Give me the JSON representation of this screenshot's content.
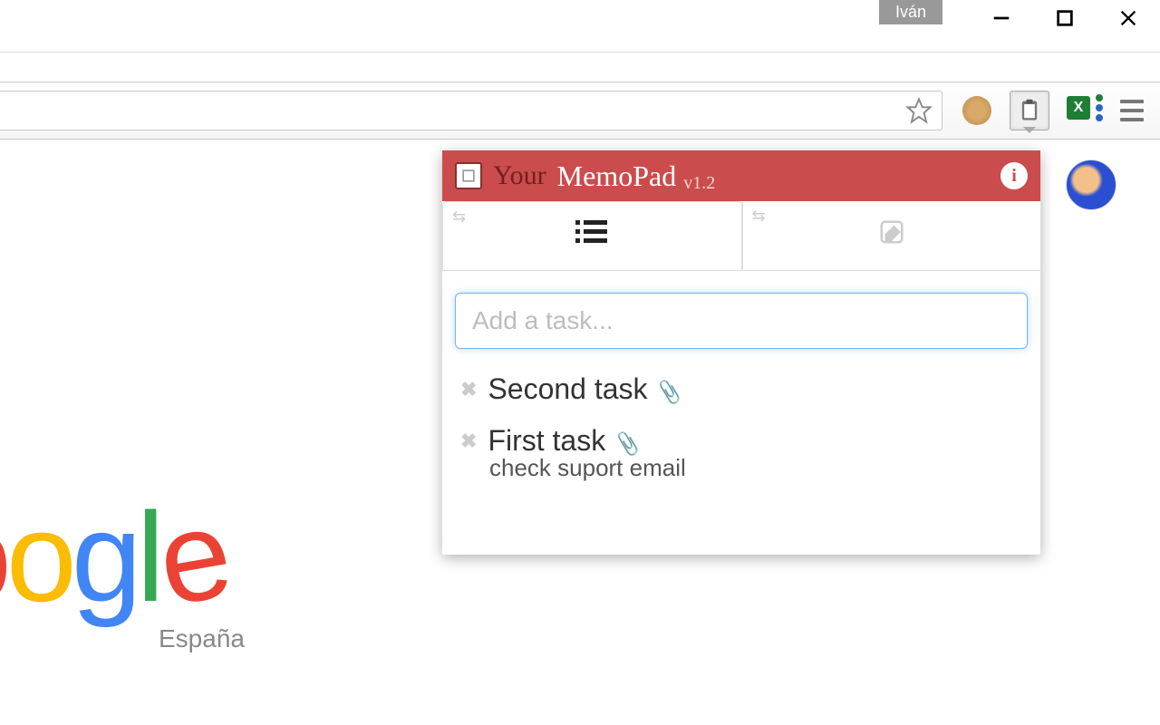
{
  "window": {
    "profile": "Iván"
  },
  "page": {
    "google_sub": "España"
  },
  "popup": {
    "title_word1": "Your",
    "title_word2": "MemoPad",
    "version": "v1.2",
    "input_placeholder": "Add a task...",
    "tasks": [
      {
        "title": "Second task",
        "sub": ""
      },
      {
        "title": "First task",
        "sub": "check suport email"
      }
    ]
  },
  "ext": {
    "xl_letter": "X"
  }
}
